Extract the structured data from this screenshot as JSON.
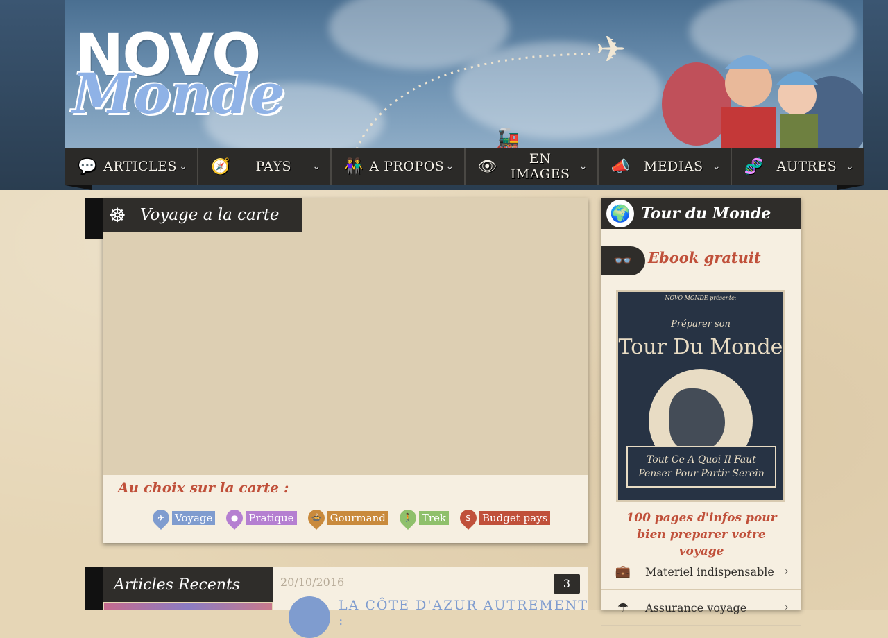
{
  "logo": {
    "top": "NOVO",
    "bottom": "Monde"
  },
  "nav": {
    "items": [
      {
        "label": "ARTICLES",
        "icon": "speech-bubble-heart-icon"
      },
      {
        "label": "PAYS",
        "icon": "compass-icon"
      },
      {
        "label": "A PROPOS",
        "icon": "couple-icon"
      },
      {
        "label": "EN IMAGES",
        "icon": "eye-icon"
      },
      {
        "label": "MEDIAS",
        "icon": "megaphone-chat-icon"
      },
      {
        "label": "AUTRES",
        "icon": "dna-icon"
      }
    ]
  },
  "map_section": {
    "title": "Voyage a la carte",
    "legend_title": "Au choix sur la carte :",
    "legend": [
      {
        "label": "Voyage",
        "color": "#7f9ccf",
        "icon": "plane-icon"
      },
      {
        "label": "Pratique",
        "color": "#b57fd1",
        "icon": "pin-icon"
      },
      {
        "label": "Gourmand",
        "color": "#c98a3c",
        "icon": "food-icon"
      },
      {
        "label": "Trek",
        "color": "#8fc06b",
        "icon": "hiker-icon"
      },
      {
        "label": "Budget pays",
        "color": "#c0503a",
        "icon": "dollar-icon"
      }
    ]
  },
  "recent": {
    "title": "Articles Recents",
    "article": {
      "date": "20/10/2016",
      "comments": "3",
      "title": "LA CÔTE D'AZUR AUTREMENT :"
    }
  },
  "sidebar": {
    "title": "Tour du Monde",
    "ebook_title": "Ebook gratuit",
    "cover": {
      "sub": "NOVO MONDE présente:",
      "pre": "Préparer son",
      "main": "Tour Du Monde",
      "banner_line1": "Tout Ce A Quoi Il Faut",
      "banner_line2": "Penser Pour Partir Serein"
    },
    "caption": "100 pages d'infos pour bien preparer votre voyage",
    "links": [
      {
        "label": "Materiel indispensable",
        "icon": "briefcase-icon"
      },
      {
        "label": "Assurance voyage",
        "icon": "umbrella-icon"
      }
    ]
  }
}
